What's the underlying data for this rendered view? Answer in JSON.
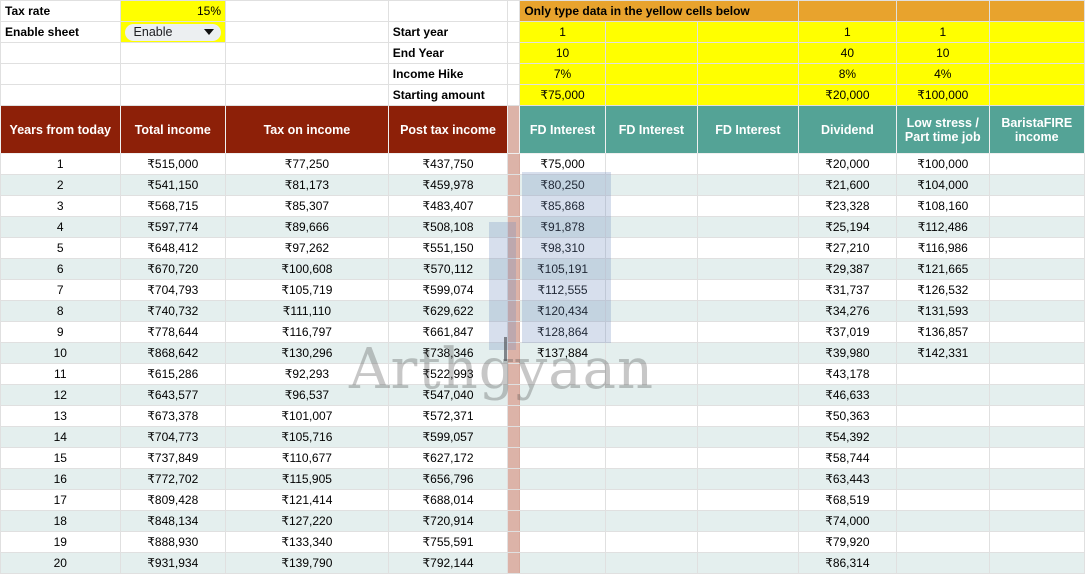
{
  "params_left": {
    "tax_rate_label": "Tax rate",
    "tax_rate_value": "15%",
    "enable_label": "Enable sheet",
    "enable_value": "Enable"
  },
  "params_mid": {
    "start_year_label": "Start year",
    "end_year_label": "End Year",
    "income_hike_label": "Income Hike",
    "starting_amount_label": "Starting amount"
  },
  "banner": {
    "text": "Only type data in the yellow cells below"
  },
  "params_values": {
    "col1": {
      "start_year": "1",
      "end_year": "10",
      "income_hike": "7%",
      "starting_amount": "₹75,000"
    },
    "col2": {
      "start_year": "1",
      "end_year": "40",
      "income_hike": "8%",
      "starting_amount": "₹20,000"
    },
    "col3": {
      "start_year": "1",
      "end_year": "10",
      "income_hike": "4%",
      "starting_amount": "₹100,000"
    }
  },
  "table": {
    "headers": [
      "Years from today",
      "Total income",
      "Tax on income",
      "Post tax income",
      "FD Interest",
      "FD Interest",
      "FD Interest",
      "Dividend",
      "Low stress / Part time job",
      "BaristaFIRE income"
    ],
    "rows": [
      {
        "year": "1",
        "total_income": "₹515,000",
        "tax_on_income": "₹77,250",
        "post_tax_income": "₹437,750",
        "fd1": "₹75,000",
        "fd2": "",
        "fd3": "",
        "dividend": "₹20,000",
        "low_stress": "₹100,000",
        "barista": ""
      },
      {
        "year": "2",
        "total_income": "₹541,150",
        "tax_on_income": "₹81,173",
        "post_tax_income": "₹459,978",
        "fd1": "₹80,250",
        "fd2": "",
        "fd3": "",
        "dividend": "₹21,600",
        "low_stress": "₹104,000",
        "barista": ""
      },
      {
        "year": "3",
        "total_income": "₹568,715",
        "tax_on_income": "₹85,307",
        "post_tax_income": "₹483,407",
        "fd1": "₹85,868",
        "fd2": "",
        "fd3": "",
        "dividend": "₹23,328",
        "low_stress": "₹108,160",
        "barista": ""
      },
      {
        "year": "4",
        "total_income": "₹597,774",
        "tax_on_income": "₹89,666",
        "post_tax_income": "₹508,108",
        "fd1": "₹91,878",
        "fd2": "",
        "fd3": "",
        "dividend": "₹25,194",
        "low_stress": "₹112,486",
        "barista": ""
      },
      {
        "year": "5",
        "total_income": "₹648,412",
        "tax_on_income": "₹97,262",
        "post_tax_income": "₹551,150",
        "fd1": "₹98,310",
        "fd2": "",
        "fd3": "",
        "dividend": "₹27,210",
        "low_stress": "₹116,986",
        "barista": ""
      },
      {
        "year": "6",
        "total_income": "₹670,720",
        "tax_on_income": "₹100,608",
        "post_tax_income": "₹570,112",
        "fd1": "₹105,191",
        "fd2": "",
        "fd3": "",
        "dividend": "₹29,387",
        "low_stress": "₹121,665",
        "barista": ""
      },
      {
        "year": "7",
        "total_income": "₹704,793",
        "tax_on_income": "₹105,719",
        "post_tax_income": "₹599,074",
        "fd1": "₹112,555",
        "fd2": "",
        "fd3": "",
        "dividend": "₹31,737",
        "low_stress": "₹126,532",
        "barista": ""
      },
      {
        "year": "8",
        "total_income": "₹740,732",
        "tax_on_income": "₹111,110",
        "post_tax_income": "₹629,622",
        "fd1": "₹120,434",
        "fd2": "",
        "fd3": "",
        "dividend": "₹34,276",
        "low_stress": "₹131,593",
        "barista": ""
      },
      {
        "year": "9",
        "total_income": "₹778,644",
        "tax_on_income": "₹116,797",
        "post_tax_income": "₹661,847",
        "fd1": "₹128,864",
        "fd2": "",
        "fd3": "",
        "dividend": "₹37,019",
        "low_stress": "₹136,857",
        "barista": ""
      },
      {
        "year": "10",
        "total_income": "₹868,642",
        "tax_on_income": "₹130,296",
        "post_tax_income": "₹738,346",
        "fd1": "₹137,884",
        "fd2": "",
        "fd3": "",
        "dividend": "₹39,980",
        "low_stress": "₹142,331",
        "barista": ""
      },
      {
        "year": "11",
        "total_income": "₹615,286",
        "tax_on_income": "₹92,293",
        "post_tax_income": "₹522,993",
        "fd1": "",
        "fd2": "",
        "fd3": "",
        "dividend": "₹43,178",
        "low_stress": "",
        "barista": ""
      },
      {
        "year": "12",
        "total_income": "₹643,577",
        "tax_on_income": "₹96,537",
        "post_tax_income": "₹547,040",
        "fd1": "",
        "fd2": "",
        "fd3": "",
        "dividend": "₹46,633",
        "low_stress": "",
        "barista": ""
      },
      {
        "year": "13",
        "total_income": "₹673,378",
        "tax_on_income": "₹101,007",
        "post_tax_income": "₹572,371",
        "fd1": "",
        "fd2": "",
        "fd3": "",
        "dividend": "₹50,363",
        "low_stress": "",
        "barista": ""
      },
      {
        "year": "14",
        "total_income": "₹704,773",
        "tax_on_income": "₹105,716",
        "post_tax_income": "₹599,057",
        "fd1": "",
        "fd2": "",
        "fd3": "",
        "dividend": "₹54,392",
        "low_stress": "",
        "barista": ""
      },
      {
        "year": "15",
        "total_income": "₹737,849",
        "tax_on_income": "₹110,677",
        "post_tax_income": "₹627,172",
        "fd1": "",
        "fd2": "",
        "fd3": "",
        "dividend": "₹58,744",
        "low_stress": "",
        "barista": ""
      },
      {
        "year": "16",
        "total_income": "₹772,702",
        "tax_on_income": "₹115,905",
        "post_tax_income": "₹656,796",
        "fd1": "",
        "fd2": "",
        "fd3": "",
        "dividend": "₹63,443",
        "low_stress": "",
        "barista": ""
      },
      {
        "year": "17",
        "total_income": "₹809,428",
        "tax_on_income": "₹121,414",
        "post_tax_income": "₹688,014",
        "fd1": "",
        "fd2": "",
        "fd3": "",
        "dividend": "₹68,519",
        "low_stress": "",
        "barista": ""
      },
      {
        "year": "18",
        "total_income": "₹848,134",
        "tax_on_income": "₹127,220",
        "post_tax_income": "₹720,914",
        "fd1": "",
        "fd2": "",
        "fd3": "",
        "dividend": "₹74,000",
        "low_stress": "",
        "barista": ""
      },
      {
        "year": "19",
        "total_income": "₹888,930",
        "tax_on_income": "₹133,340",
        "post_tax_income": "₹755,591",
        "fd1": "",
        "fd2": "",
        "fd3": "",
        "dividend": "₹79,920",
        "low_stress": "",
        "barista": ""
      },
      {
        "year": "20",
        "total_income": "₹931,934",
        "tax_on_income": "₹139,790",
        "post_tax_income": "₹792,144",
        "fd1": "",
        "fd2": "",
        "fd3": "",
        "dividend": "₹86,314",
        "low_stress": "",
        "barista": ""
      }
    ]
  },
  "watermark": {
    "text": "Arthgyaan"
  },
  "colors": {
    "header_primary": "#8d2008",
    "header_secondary": "#54a396",
    "input_highlight": "#ffff00",
    "banner": "#e8a32d",
    "separator": "#dcb3a8",
    "row_alt": "#e4efee",
    "selection": "#6e8cbe"
  }
}
